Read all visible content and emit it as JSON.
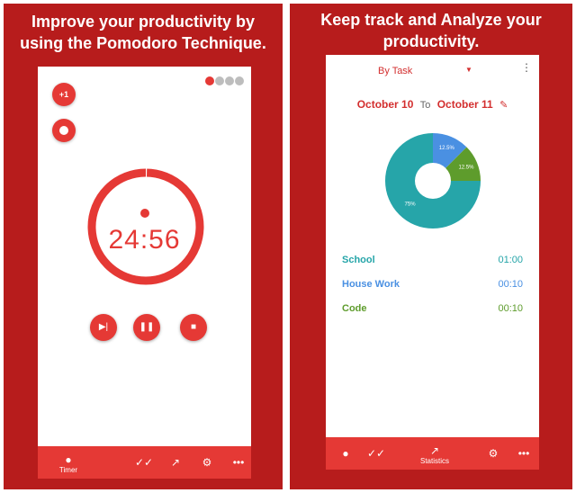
{
  "left": {
    "headline": [
      "Improve your productivity by",
      "using the Pomodoro Technique."
    ],
    "plus_label": "+1",
    "timer": "24:56",
    "progress": 0.003,
    "sessions": [
      "#e53935",
      "#bdbdbd",
      "#bdbdbd",
      "#bdbdbd"
    ],
    "nav": [
      {
        "icon": "brain-icon",
        "label": "Timer"
      },
      {
        "icon": "check-done-icon",
        "label": ""
      },
      {
        "icon": "trend-icon",
        "label": ""
      },
      {
        "icon": "gear-icon",
        "label": ""
      },
      {
        "icon": "more-icon",
        "label": ""
      }
    ]
  },
  "right": {
    "headline": [
      "Keep track and Analyze your",
      "productivity."
    ],
    "dropdown": "By Task",
    "date_from": "October 10",
    "date_to_word": "To",
    "date_to": "October 11",
    "tasks": [
      {
        "name": "School",
        "duration": "01:00",
        "color": "#26a5a9"
      },
      {
        "name": "House Work",
        "duration": "00:10",
        "color": "#4a90e2"
      },
      {
        "name": "Code",
        "duration": "00:10",
        "color": "#5e9c2c"
      }
    ],
    "nav": [
      {
        "icon": "brain-icon",
        "label": ""
      },
      {
        "icon": "check-done-icon",
        "label": ""
      },
      {
        "icon": "trend-icon",
        "label": "Statistics"
      },
      {
        "icon": "gear-icon",
        "label": ""
      },
      {
        "icon": "more-icon",
        "label": ""
      }
    ]
  },
  "chart_data": {
    "type": "pie",
    "categories": [
      "School",
      "House Work",
      "Code"
    ],
    "values": [
      75,
      12.5,
      12.5
    ],
    "labels": [
      "75%",
      "12.5%",
      "12.5%"
    ],
    "colors": [
      "#26a5a9",
      "#4a90e2",
      "#5e9c2c"
    ],
    "donut": true
  },
  "accent": "#e53935",
  "brand_dark": "#b71c1c"
}
